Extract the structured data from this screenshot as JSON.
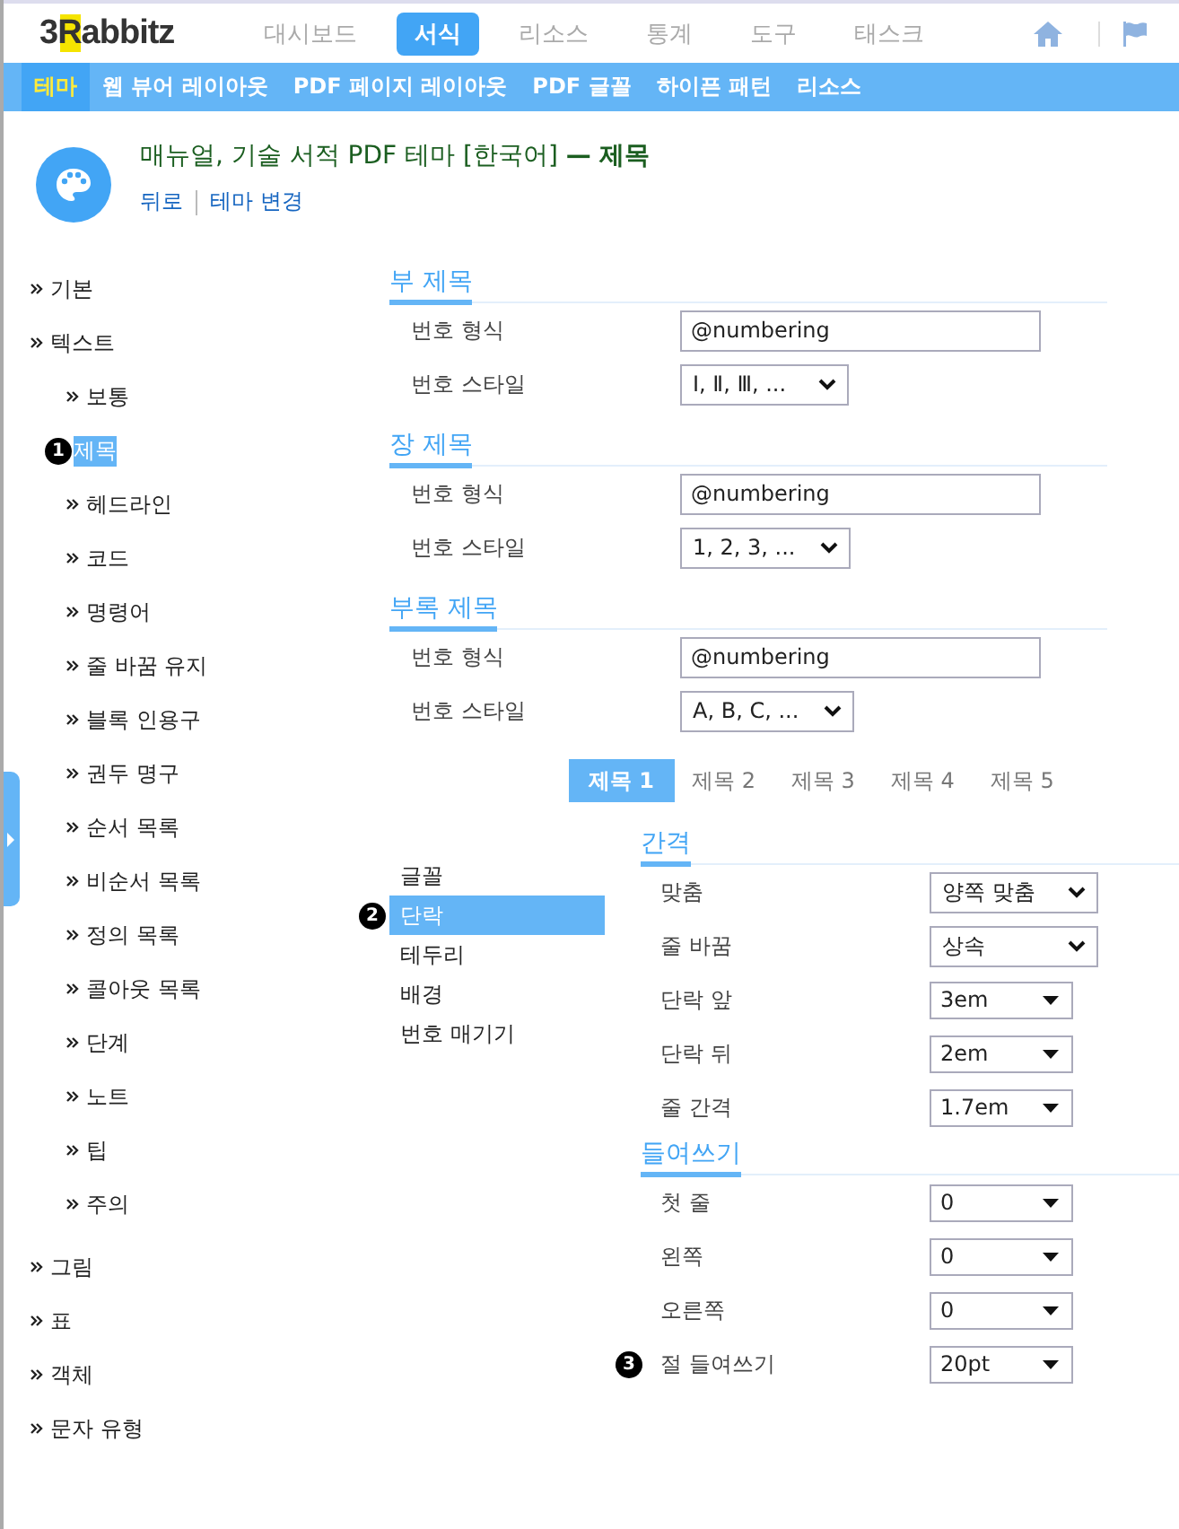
{
  "logo": {
    "mark": "3R",
    "name": "abbitz"
  },
  "top_nav": [
    {
      "label": "대시보드",
      "selected": false
    },
    {
      "label": "서식",
      "selected": true
    },
    {
      "label": "리소스",
      "selected": false
    },
    {
      "label": "통계",
      "selected": false
    },
    {
      "label": "도구",
      "selected": false
    },
    {
      "label": "태스크",
      "selected": false
    }
  ],
  "sub_nav": [
    {
      "label": "테마",
      "selected": true
    },
    {
      "label": "웹 뷰어 레이아웃",
      "selected": false
    },
    {
      "label": "PDF 페이지 레이아웃",
      "selected": false
    },
    {
      "label": "PDF 글꼴",
      "selected": false
    },
    {
      "label": "하이픈 패턴",
      "selected": false
    },
    {
      "label": "리소스",
      "selected": false
    }
  ],
  "page": {
    "title": "매뉴얼, 기술 서적 PDF 테마 [한국어] **— 제목**",
    "links": [
      "뒤로",
      "테마 변경"
    ]
  },
  "sidebar": {
    "items": [
      {
        "label": "기본",
        "selected": false
      },
      {
        "label": "텍스트",
        "selected": false,
        "children": [
          {
            "label": "보통",
            "selected": false
          },
          {
            "label": "제목",
            "selected": true,
            "badge": "1"
          },
          {
            "label": "헤드라인",
            "selected": false
          },
          {
            "label": "코드",
            "selected": false
          },
          {
            "label": "명령어",
            "selected": false
          },
          {
            "label": "줄 바꿈 유지",
            "selected": false
          },
          {
            "label": "블록 인용구",
            "selected": false
          },
          {
            "label": "권두 명구",
            "selected": false
          },
          {
            "label": "순서 목록",
            "selected": false
          },
          {
            "label": "비순서 목록",
            "selected": false
          },
          {
            "label": "정의 목록",
            "selected": false
          },
          {
            "label": "콜아웃 목록",
            "selected": false
          },
          {
            "label": "단계",
            "selected": false
          },
          {
            "label": "노트",
            "selected": false
          },
          {
            "label": "팁",
            "selected": false
          },
          {
            "label": "주의",
            "selected": false
          }
        ]
      },
      {
        "label": "그림",
        "selected": false
      },
      {
        "label": "표",
        "selected": false
      },
      {
        "label": "객체",
        "selected": false
      },
      {
        "label": "문자 유형",
        "selected": false
      }
    ]
  },
  "sections": [
    {
      "title": "부 제목",
      "rows": [
        {
          "label": "번호 형식",
          "kind": "input",
          "value": "@numbering"
        },
        {
          "label": "번호 스타일",
          "kind": "select",
          "value": "Ⅰ, Ⅱ, Ⅲ, ..."
        }
      ]
    },
    {
      "title": "장 제목",
      "rows": [
        {
          "label": "번호 형식",
          "kind": "input",
          "value": "@numbering"
        },
        {
          "label": "번호 스타일",
          "kind": "select",
          "value": "1, 2, 3, ..."
        }
      ]
    },
    {
      "title": "부록 제목",
      "rows": [
        {
          "label": "번호 형식",
          "kind": "input",
          "value": "@numbering"
        },
        {
          "label": "번호 스타일",
          "kind": "select",
          "value": "A, B, C, ..."
        }
      ]
    }
  ],
  "heading_tabs": [
    {
      "label": "제목 1",
      "selected": true
    },
    {
      "label": "제목 2",
      "selected": false
    },
    {
      "label": "제목 3",
      "selected": false
    },
    {
      "label": "제목 4",
      "selected": false
    },
    {
      "label": "제목 5",
      "selected": false
    }
  ],
  "style_menu": [
    {
      "label": "글꼴",
      "selected": false
    },
    {
      "label": "단락",
      "selected": true,
      "badge": "2"
    },
    {
      "label": "테두리",
      "selected": false
    },
    {
      "label": "배경",
      "selected": false
    },
    {
      "label": "번호 매기기",
      "selected": false
    }
  ],
  "groups": [
    {
      "title": "간격",
      "rows": [
        {
          "label": "맞춤",
          "kind": "select",
          "value": "양쪽 맞춤"
        },
        {
          "label": "줄 바꿈",
          "kind": "select",
          "value": "상속"
        },
        {
          "label": "단락 앞",
          "kind": "combo",
          "value": "3em"
        },
        {
          "label": "단락 뒤",
          "kind": "combo",
          "value": "2em"
        },
        {
          "label": "줄 간격",
          "kind": "combo",
          "value": "1.7em"
        }
      ]
    },
    {
      "title": "들여쓰기",
      "rows": [
        {
          "label": "첫 줄",
          "kind": "combo",
          "value": "0"
        },
        {
          "label": "왼쪽",
          "kind": "combo",
          "value": "0"
        },
        {
          "label": "오른쪽",
          "kind": "combo",
          "value": "0"
        },
        {
          "label": "절 들여쓰기",
          "kind": "combo",
          "value": "20pt",
          "badge": "3"
        }
      ]
    }
  ]
}
